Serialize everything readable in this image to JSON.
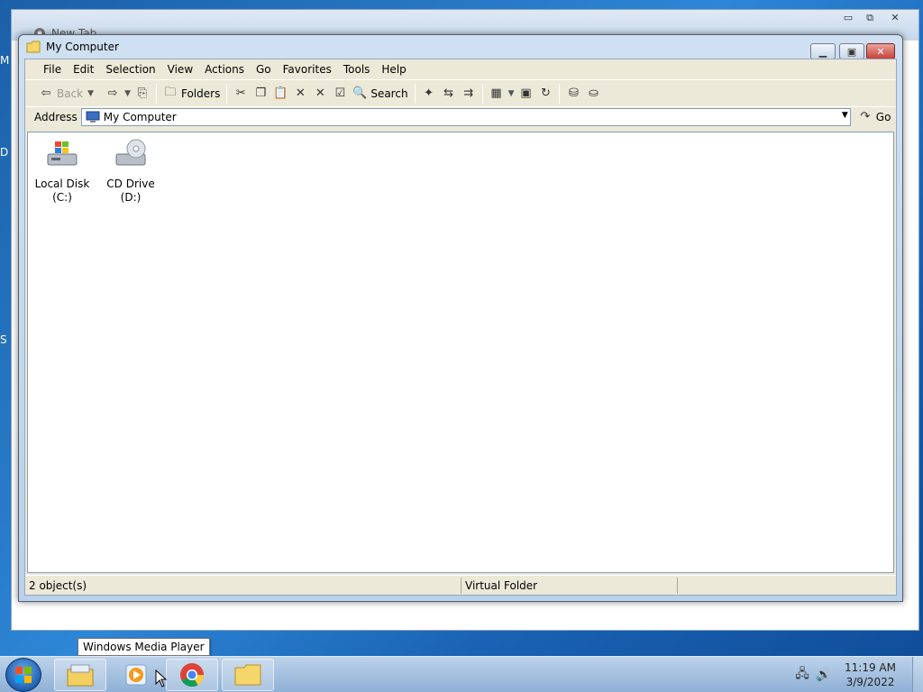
{
  "desktop": {
    "edge_labels": [
      "M",
      "D",
      "S"
    ]
  },
  "background_window": {
    "tab_title": "New Tab",
    "controls": [
      "▭",
      "⧉",
      "✕"
    ]
  },
  "window": {
    "title": "My Computer",
    "controls": {
      "minimize": "▁",
      "maximize": "▣",
      "close": "✕"
    },
    "menu": [
      "File",
      "Edit",
      "Selection",
      "View",
      "Actions",
      "Go",
      "Favorites",
      "Tools",
      "Help"
    ],
    "toolbar": {
      "back_label": "Back",
      "folders_label": "Folders",
      "search_label": "Search"
    },
    "address": {
      "label": "Address",
      "value": "My Computer",
      "go_label": "Go"
    },
    "drives": [
      {
        "label": "Local Disk (C:)",
        "icon": "hard-drive-icon"
      },
      {
        "label": "CD Drive (D:)",
        "icon": "cd-drive-icon"
      }
    ],
    "status": {
      "objects": "2 object(s)",
      "location": "Virtual Folder"
    }
  },
  "tooltip": "Windows Media Player",
  "taskbar": {
    "items": [
      "file-explorer-icon",
      "media-player-icon",
      "chrome-icon",
      "folder-icon"
    ],
    "clock": {
      "time": "11:19 AM",
      "date": "3/9/2022"
    }
  },
  "colors": {
    "desktop": "#2d86d6",
    "window_frame": "#b9d1ea",
    "client": "#ece9d8",
    "close_button": "#c7413a"
  }
}
